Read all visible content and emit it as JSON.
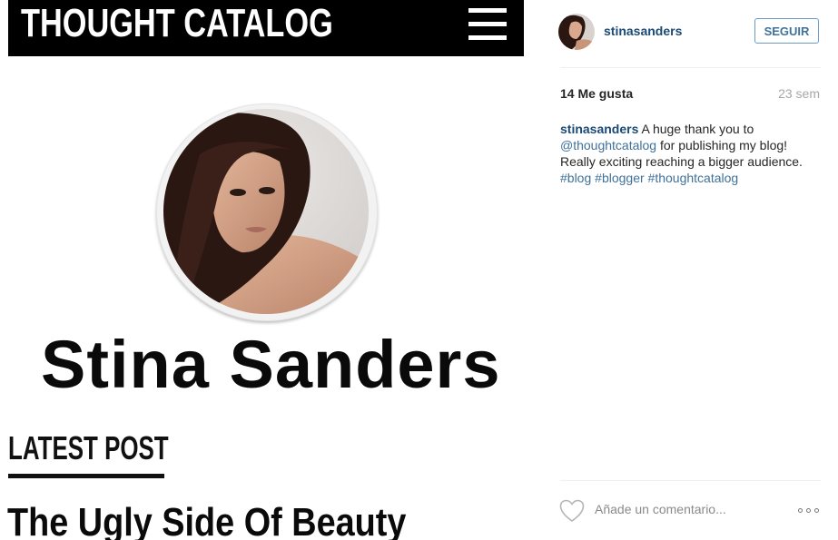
{
  "post_image": {
    "site_logo": "THOUGHT CATALOG",
    "menu_icon": "hamburger-menu-icon",
    "author_name": "Stina Sanders",
    "section_label": "LATEST POST",
    "article_title": "The Ugly Side Of Beauty"
  },
  "header": {
    "username": "stinasanders",
    "follow_label": "SEGUIR"
  },
  "stats": {
    "likes": "14 Me gusta",
    "time_ago": "23 sem"
  },
  "caption": {
    "username": "stinasanders",
    "text_1": " A huge thank you to ",
    "mention": "@thoughtcatalog",
    "text_2": " for publishing my blog! Really exciting reaching a bigger audience. ",
    "hashtags": [
      "#blog",
      "#blogger",
      "#thoughtcatalog"
    ]
  },
  "comment_bar": {
    "like_icon": "heart-icon",
    "placeholder": "Añade un comentario...",
    "more_icon": "more-options-icon"
  },
  "colors": {
    "link": "#3f729b",
    "username": "#1a4a75",
    "muted": "#a5a7aa"
  }
}
